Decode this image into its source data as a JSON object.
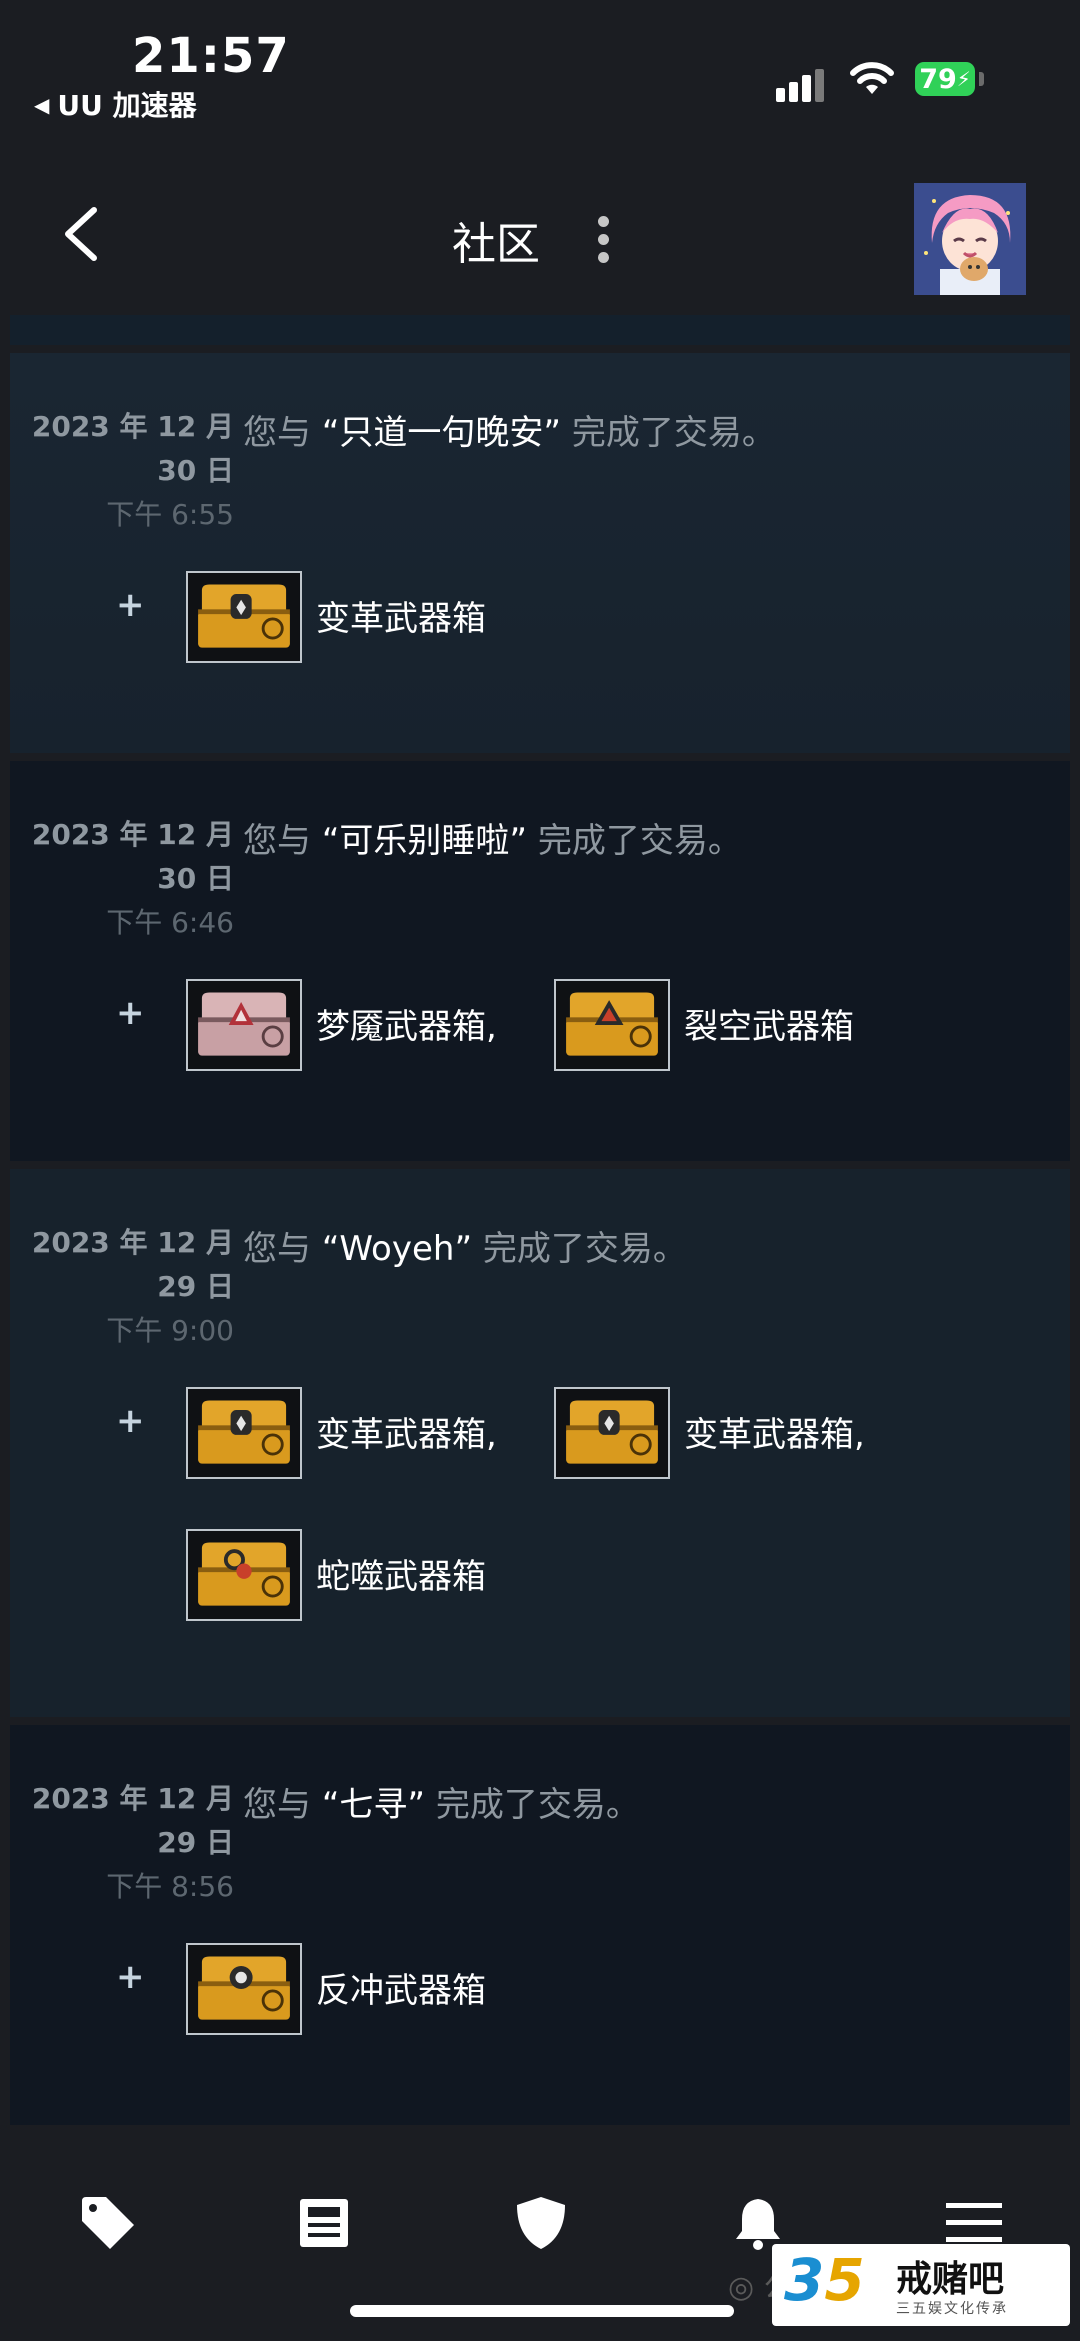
{
  "status_bar": {
    "time": "21:57",
    "back_app": "UU 加速器",
    "battery": "79"
  },
  "nav": {
    "title": "社区"
  },
  "trades": [
    {
      "date": "2023 年 12 月",
      "day": "30 日",
      "time": "下午 6:55",
      "prefix": "您与 ",
      "partner": "“只道一句晚安”",
      "suffix": " 完成了交易。",
      "plus": "+",
      "items": [
        "变革武器箱"
      ]
    },
    {
      "date": "2023 年 12 月",
      "day": "30 日",
      "time": "下午 6:46",
      "prefix": "您与 ",
      "partner": "“可乐别睡啦”",
      "suffix": " 完成了交易。",
      "plus": "+",
      "items": [
        "梦魇武器箱,",
        "裂空武器箱"
      ]
    },
    {
      "date": "2023 年 12 月",
      "day": "29 日",
      "time": "下午 9:00",
      "prefix": "您与 ",
      "partner": "“Woyeh”",
      "suffix": " 完成了交易。",
      "plus": "+",
      "items": [
        "变革武器箱,",
        "变革武器箱,",
        "蛇噬武器箱"
      ]
    },
    {
      "date": "2023 年 12 月",
      "day": "29 日",
      "time": "下午 8:56",
      "prefix": "您与 ",
      "partner": "“七寻”",
      "suffix": " 完成了交易。",
      "plus": "+",
      "items": [
        "反冲武器箱"
      ]
    }
  ],
  "watermark": {
    "wechat": "公众",
    "num3": "3",
    "num5": "5",
    "name": "戒赌吧",
    "sub": "三五娱文化传承"
  },
  "colors": {
    "background": "#1b1d22",
    "card_text": "#8f98a0",
    "case_gold": "#d99a1e",
    "case_pink": "#c8a0a4"
  },
  "icons": [
    "tag-icon",
    "news-icon",
    "shield-icon",
    "bell-icon",
    "menu-icon"
  ]
}
